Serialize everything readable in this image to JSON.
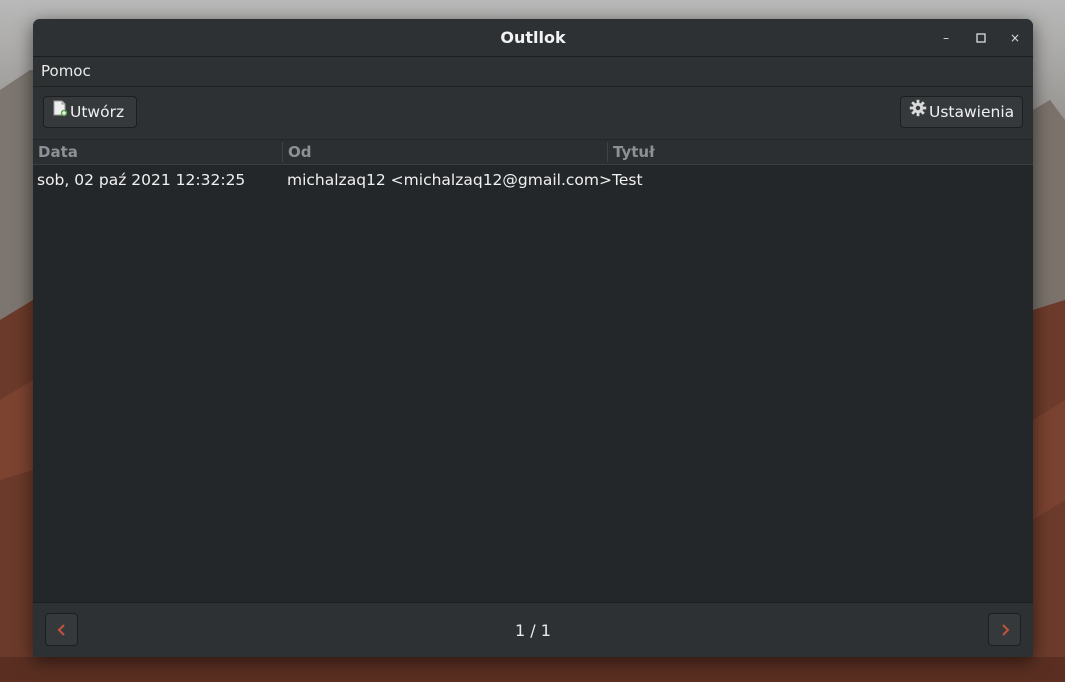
{
  "window": {
    "title": "Outllok",
    "controls": {
      "minimize": "–",
      "maximize": "□",
      "close": "×"
    }
  },
  "menubar": {
    "items": [
      {
        "label": "Pomoc"
      }
    ]
  },
  "toolbar": {
    "create_label": "Utwórz",
    "settings_label": "Ustawienia"
  },
  "table": {
    "columns": [
      "Data",
      "Od",
      "Tytuł"
    ],
    "rows": [
      {
        "date": "sob, 02 paź 2021 12:32:25",
        "from": "michalzaq12 <michalzaq12@gmail.com>",
        "title": "Test"
      }
    ]
  },
  "pagination": {
    "text": "1 / 1"
  },
  "colors": {
    "accent_arrow": "#c0553a",
    "window_bg": "#23272a",
    "toolbar_bg": "#2d3134"
  },
  "icons": {
    "create": "new-document-icon",
    "settings": "gear-icon",
    "prev": "chevron-left-icon",
    "next": "chevron-right-icon"
  }
}
